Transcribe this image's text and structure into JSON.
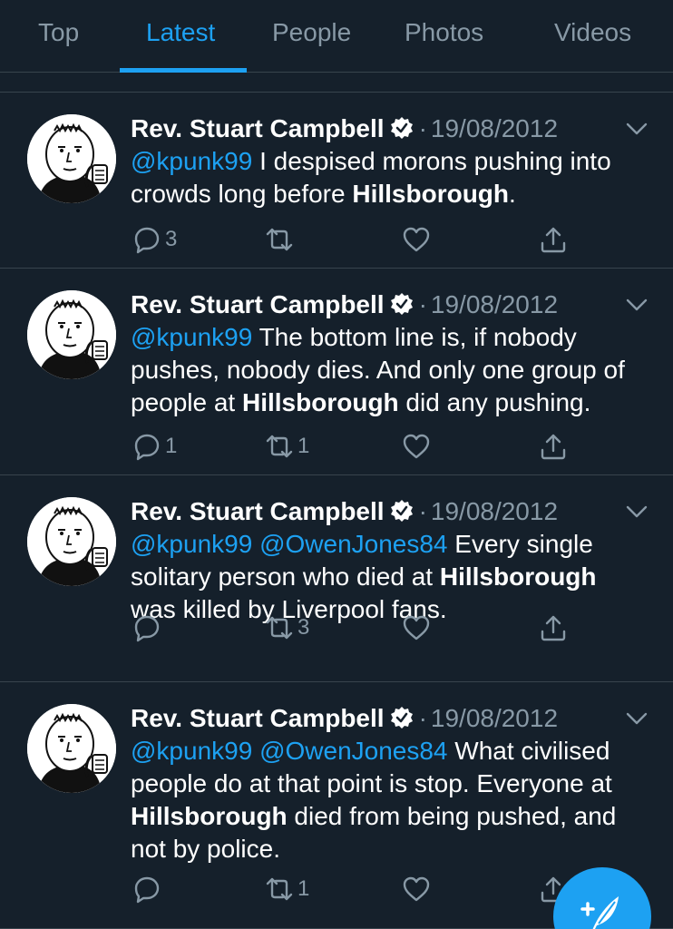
{
  "tabs": [
    {
      "label": "Top"
    },
    {
      "label": "Latest"
    },
    {
      "label": "People"
    },
    {
      "label": "Photos"
    },
    {
      "label": "Videos"
    }
  ],
  "tweets": [
    {
      "name": "Rev. Stuart Campbell",
      "date": "19/08/2012",
      "body": [
        {
          "t": "@kpunk99",
          "s": "mention"
        },
        {
          "t": " I despised morons pushing into crowds long before ",
          "s": ""
        },
        {
          "t": "Hillsborough",
          "s": "bold"
        },
        {
          "t": ".",
          "s": ""
        }
      ],
      "replies": "3",
      "retweets": "",
      "likes": ""
    },
    {
      "name": "Rev. Stuart Campbell",
      "date": "19/08/2012",
      "body": [
        {
          "t": "@kpunk99",
          "s": "mention"
        },
        {
          "t": " The bottom line is, if nobody pushes, nobody dies. And only one group of people at ",
          "s": ""
        },
        {
          "t": "Hillsborough",
          "s": "bold"
        },
        {
          "t": " did any pushing.",
          "s": ""
        }
      ],
      "replies": "1",
      "retweets": "1",
      "likes": ""
    },
    {
      "name": "Rev. Stuart Campbell",
      "date": "19/08/2012",
      "body": [
        {
          "t": "@kpunk99",
          "s": "mention"
        },
        {
          "t": " ",
          "s": ""
        },
        {
          "t": "@OwenJones84",
          "s": "mention"
        },
        {
          "t": " Every single solitary person who died at ",
          "s": ""
        },
        {
          "t": "Hillsborough",
          "s": "bold"
        },
        {
          "t": " was killed by Liverpool fans.",
          "s": ""
        }
      ],
      "replies": "",
      "retweets": "3",
      "likes": ""
    },
    {
      "name": "Rev. Stuart Campbell",
      "date": "19/08/2012",
      "body": [
        {
          "t": "@kpunk99",
          "s": "mention"
        },
        {
          "t": " ",
          "s": ""
        },
        {
          "t": "@OwenJones84",
          "s": "mention"
        },
        {
          "t": " What civilised people do at that point is stop. Everyone at ",
          "s": ""
        },
        {
          "t": "Hillsborough",
          "s": "bold"
        },
        {
          "t": " died from being pushed, and not by police.",
          "s": ""
        }
      ],
      "replies": "",
      "retweets": "1",
      "likes": ""
    }
  ],
  "dot_separator": "·",
  "icons": {
    "reply": "reply-icon",
    "retweet": "retweet-icon",
    "like": "heart-icon",
    "share": "share-icon",
    "verified": "verified-badge-icon",
    "more": "chevron-down-icon",
    "compose": "compose-tweet-icon"
  },
  "colors": {
    "background": "#15202b",
    "accent": "#1da1f2",
    "secondary_text": "#8899a6",
    "divider": "#38444d"
  }
}
